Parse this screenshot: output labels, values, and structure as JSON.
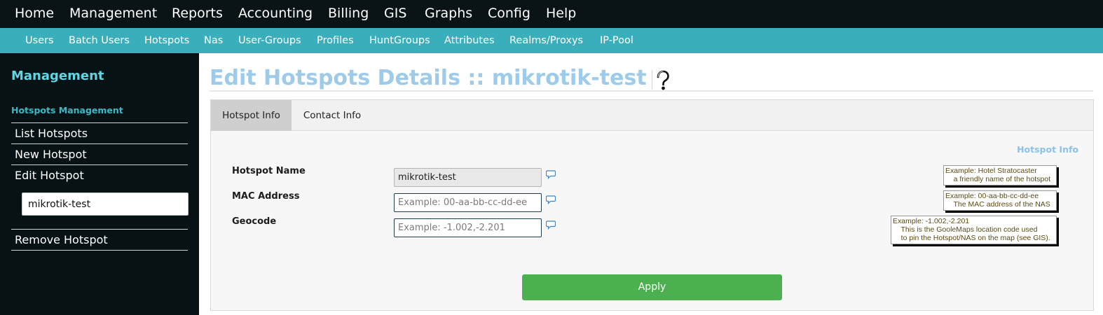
{
  "top_nav": [
    "Home",
    "Management",
    "Reports",
    "Accounting",
    "Billing",
    "GIS",
    "Graphs",
    "Config",
    "Help"
  ],
  "sub_nav": [
    "Users",
    "Batch Users",
    "Hotspots",
    "Nas",
    "User-Groups",
    "Profiles",
    "HuntGroups",
    "Attributes",
    "Realms/Proxys",
    "IP-Pool"
  ],
  "sidebar": {
    "title": "Management",
    "section": "Hotspots Management",
    "links": {
      "list": "List Hotspots",
      "new": "New Hotspot",
      "edit": "Edit Hotspot",
      "remove": "Remove Hotspot"
    },
    "edit_value": "mikrotik-test"
  },
  "page": {
    "title": "Edit Hotspots Details :: mikrotik-test",
    "help_icon": "question-mark-icon"
  },
  "tabs": [
    "Hotspot Info",
    "Contact Info"
  ],
  "active_tab": "Hotspot Info",
  "legend": "Hotspot Info",
  "fields": {
    "name": {
      "label": "Hotspot Name",
      "value": "mikrotik-test",
      "disabled": true
    },
    "mac": {
      "label": "MAC Address",
      "value": "",
      "placeholder": "Example: 00-aa-bb-cc-dd-ee"
    },
    "geocode": {
      "label": "Geocode",
      "value": "",
      "placeholder": "Example: -1.002,-2.201"
    }
  },
  "tooltips": {
    "name": "Example: Hotel Stratocaster\n    a friendly name of the hotspot",
    "mac": "Example: 00-aa-bb-cc-dd-ee\n    The MAC address of the NAS",
    "geocode": "Example: -1.002,-2.201\n    This is the GooleMaps location code used\n    to pin the Hotspot/NAS on the map (see GIS)."
  },
  "apply_label": "Apply",
  "colors": {
    "top_nav_bg": "#0a1416",
    "sub_nav_bg": "#3aaeba",
    "sidebar_bg": "#071214",
    "title": "#9ecbea",
    "apply_bg": "#4caf50"
  }
}
